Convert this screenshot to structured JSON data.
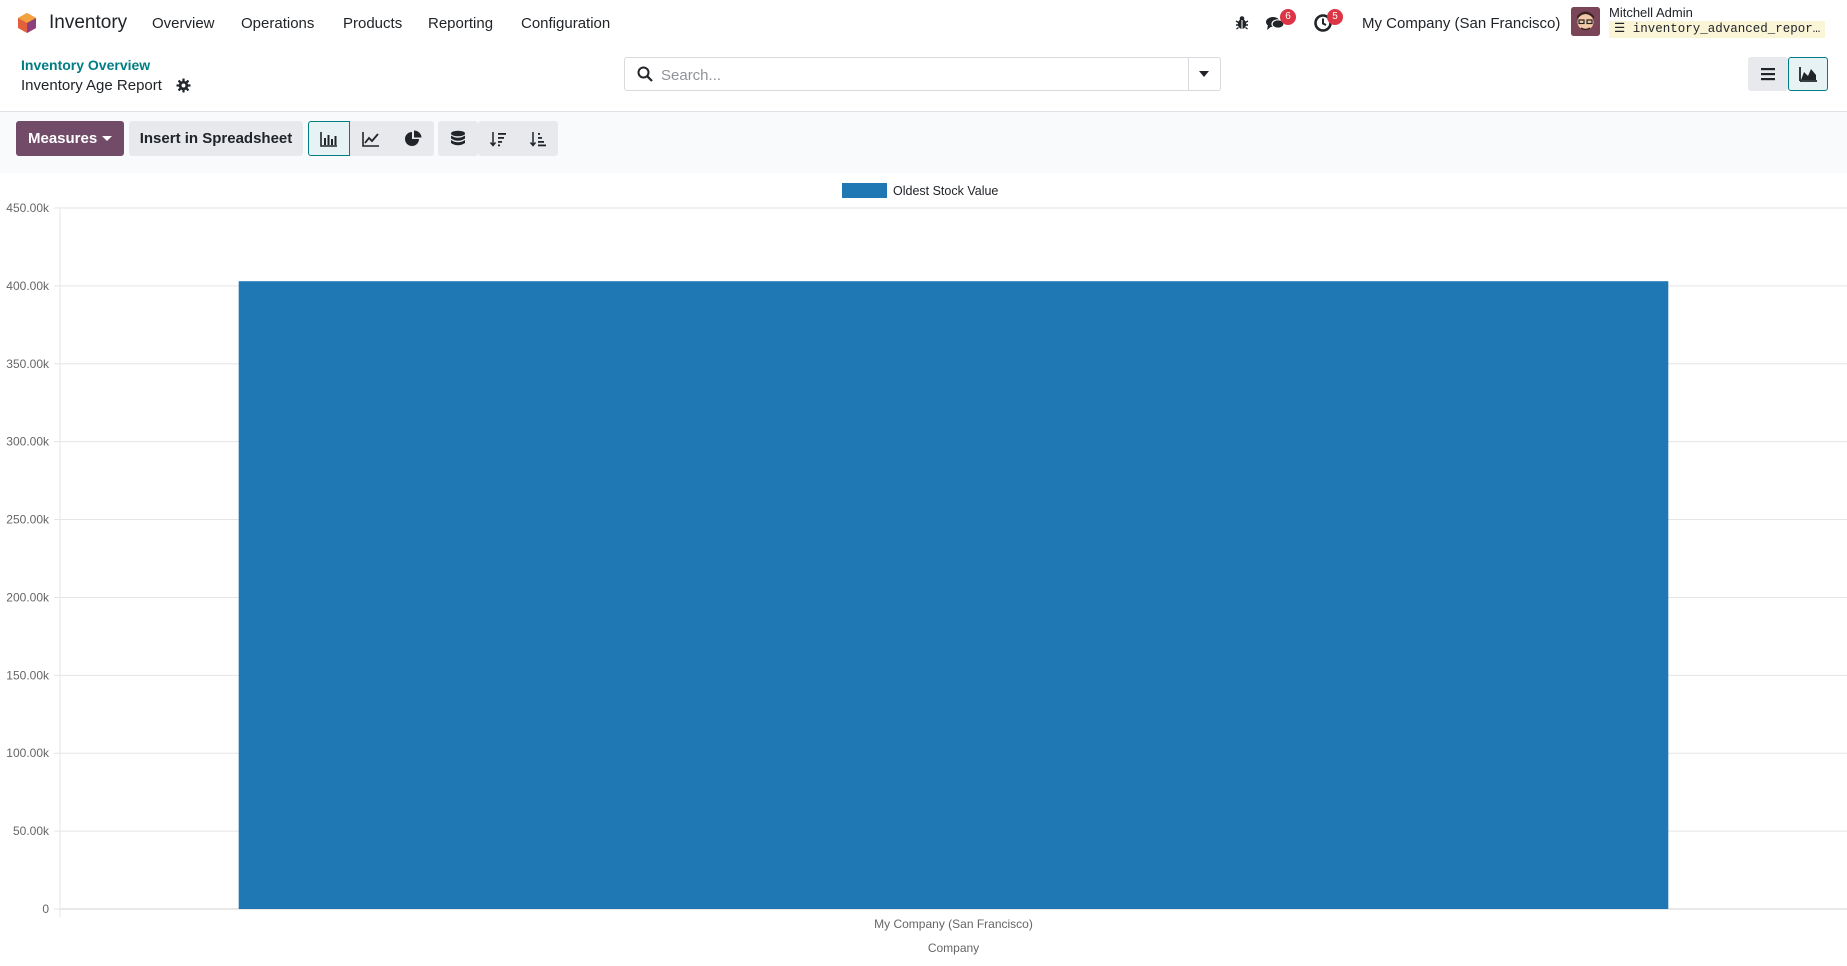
{
  "navbar": {
    "app_name": "Inventory",
    "menus": [
      "Overview",
      "Operations",
      "Products",
      "Reporting",
      "Configuration"
    ],
    "icons": {
      "debug": "bug-icon",
      "messages": "chat-icon",
      "activities": "clock-icon"
    },
    "messages_count": "6",
    "activities_count": "5",
    "company": "My Company (San Francisco)",
    "user_name": "Mitchell Admin",
    "database": "inventory_advanced_repor…"
  },
  "control_panel": {
    "breadcrumb": "Inventory Overview",
    "title": "Inventory Age Report",
    "search_placeholder": "Search..."
  },
  "toolbar": {
    "measures_label": "Measures",
    "spreadsheet_label": "Insert in Spreadsheet",
    "chart_modes": [
      "bar-chart-icon",
      "line-chart-icon",
      "pie-chart-icon"
    ],
    "active_mode": "bar-chart-icon",
    "other_tools": [
      "stacked-icon",
      "sort-descending-icon",
      "sort-ascending-icon"
    ]
  },
  "colors": {
    "brand": "#714b67",
    "accent": "#017e84",
    "bar": "#1f77b4",
    "badge": "#dc3545"
  },
  "chart_data": {
    "type": "bar",
    "categories": [
      "My Company (San Francisco)"
    ],
    "series": [
      {
        "name": "Oldest Stock Value",
        "values": [
          403000
        ]
      }
    ],
    "title": "",
    "xlabel": "Company",
    "ylabel": "",
    "ylim": [
      0,
      450000
    ],
    "yticks": [
      "0",
      "50.00k",
      "100.00k",
      "150.00k",
      "200.00k",
      "250.00k",
      "300.00k",
      "350.00k",
      "400.00k",
      "450.00k"
    ],
    "grid": true,
    "legend_position": "top-center"
  }
}
